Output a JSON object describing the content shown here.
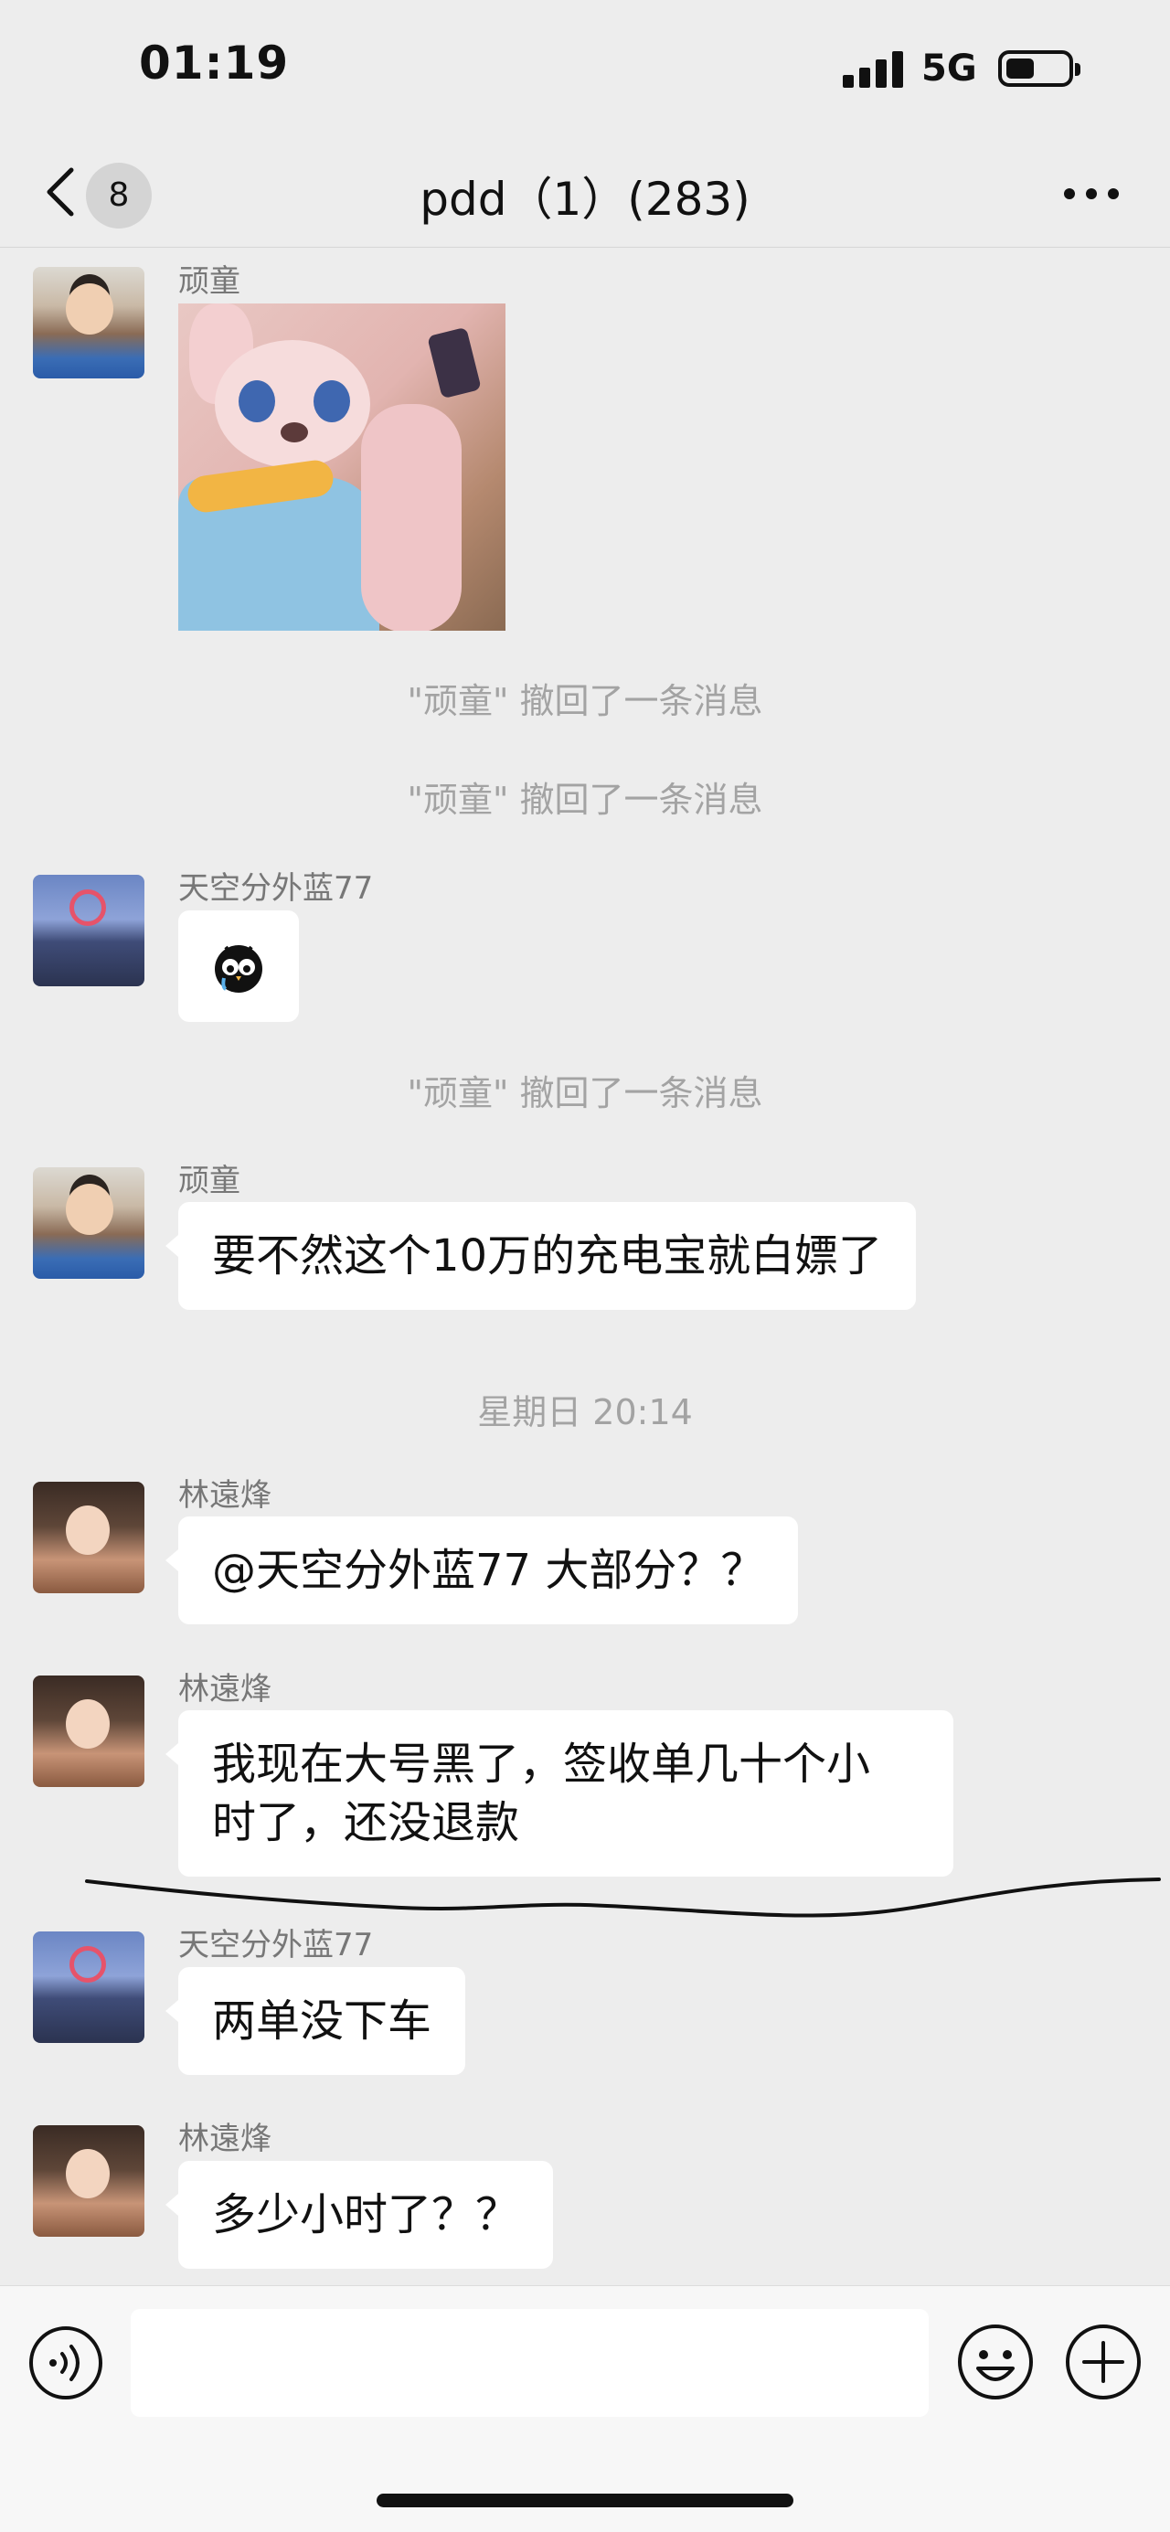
{
  "status_bar": {
    "time": "01:19",
    "network": "5G"
  },
  "header": {
    "unread_count": "8",
    "title": "pdd（1）(283)"
  },
  "messages": [
    {
      "type": "image",
      "sender": "顽童"
    },
    {
      "type": "system",
      "text": "\"顽童\" 撤回了一条消息"
    },
    {
      "type": "system",
      "text": "\"顽童\" 撤回了一条消息"
    },
    {
      "type": "sticker",
      "sender": "天空分外蓝77",
      "icon": "owl-emoji-icon"
    },
    {
      "type": "system",
      "text": "\"顽童\" 撤回了一条消息"
    },
    {
      "type": "text",
      "sender": "顽童",
      "text": "要不然这个10万的充电宝就白嫖了"
    },
    {
      "type": "timestamp",
      "text": "星期日 20:14"
    },
    {
      "type": "text",
      "sender": "林遠烽",
      "text": "@天空分外蓝77 大部分？？"
    },
    {
      "type": "text",
      "sender": "林遠烽",
      "lines": [
        "我现在大号黑了，签收单几十个小",
        "时了，还没退款"
      ]
    },
    {
      "type": "text",
      "sender": "天空分外蓝77",
      "text": "两单没下车"
    },
    {
      "type": "text",
      "sender": "林遠烽",
      "text": "多少小时了？？"
    }
  ],
  "input_bar": {
    "placeholder": "",
    "icons": [
      "voice-icon",
      "emoji-icon",
      "plus-icon"
    ]
  },
  "colors": {
    "background": "#ededed",
    "bubble": "#ffffff",
    "system_text": "#a3a3a3"
  }
}
